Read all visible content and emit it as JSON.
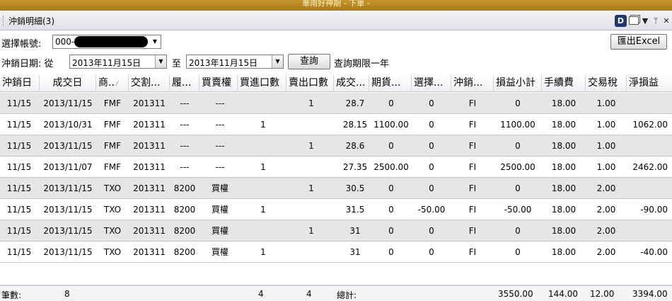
{
  "window": {
    "title": "華南好神期 - 下單 -"
  },
  "panel": {
    "title": "沖銷明細(3)"
  },
  "controls": {
    "account_label": "選擇帳號:",
    "account_value": "000-",
    "date_label": "沖銷日期: 從",
    "from_date": "2013年11月15日",
    "to_label": "至",
    "to_date": "2013年11月15日",
    "query_button": "查詢",
    "query_note": "查詢期限一年",
    "export_button": "匯出Excel"
  },
  "columns": [
    "沖銷日",
    "成交日",
    "商..",
    "交割...",
    "履...",
    "買賣權",
    "買進口數",
    "賣出口數",
    "成交...",
    "期貨...",
    "選擇...",
    "沖銷...",
    "損益小計",
    "手續費",
    "交易稅",
    "淨損益"
  ],
  "rows": [
    [
      "11/15",
      "2013/11/15",
      "FMF",
      "201311",
      "---",
      "---",
      "",
      "1",
      "28.7",
      "0",
      "0",
      "FI",
      "0",
      "18.00",
      "1.00",
      ""
    ],
    [
      "11/15",
      "2013/10/31",
      "FMF",
      "201311",
      "---",
      "---",
      "1",
      "",
      "28.15",
      "1100.00",
      "0",
      "FI",
      "1100.00",
      "18.00",
      "1.00",
      "1062.00"
    ],
    [
      "11/15",
      "2013/11/15",
      "FMF",
      "201311",
      "---",
      "---",
      "",
      "1",
      "28.6",
      "0",
      "0",
      "FI",
      "0",
      "18.00",
      "1.00",
      ""
    ],
    [
      "11/15",
      "2013/11/07",
      "FMF",
      "201311",
      "---",
      "---",
      "1",
      "",
      "27.35",
      "2500.00",
      "0",
      "FI",
      "2500.00",
      "18.00",
      "1.00",
      "2462.00"
    ],
    [
      "11/15",
      "2013/11/15",
      "TXO",
      "201311",
      "8200",
      "買權",
      "",
      "1",
      "30.5",
      "0",
      "0",
      "FI",
      "0",
      "18.00",
      "2.00",
      ""
    ],
    [
      "11/15",
      "2013/11/15",
      "TXO",
      "201311",
      "8200",
      "買權",
      "1",
      "",
      "31.5",
      "0",
      "-50.00",
      "FI",
      "-50.00",
      "18.00",
      "2.00",
      "-90.00"
    ],
    [
      "11/15",
      "2013/11/15",
      "TXO",
      "201311",
      "8200",
      "買權",
      "",
      "1",
      "31",
      "0",
      "0",
      "FI",
      "0",
      "18.00",
      "2.00",
      ""
    ],
    [
      "11/15",
      "2013/11/15",
      "TXO",
      "201311",
      "8200",
      "買權",
      "1",
      "",
      "31",
      "0",
      "0",
      "FI",
      "0",
      "18.00",
      "2.00",
      "-40.00"
    ]
  ],
  "footer": {
    "count_label": "筆數:",
    "count": "8",
    "buy_total": "4",
    "sell_total": "4",
    "total_label": "總計:",
    "pl_total": "3550.00",
    "fee_total": "144.00",
    "tax_total": "12.00",
    "net_total": "3394.00"
  },
  "colors": {
    "titlebar": "#b8862a",
    "alt_row": "#e6e6e6",
    "logo": "#1d3a6e"
  }
}
